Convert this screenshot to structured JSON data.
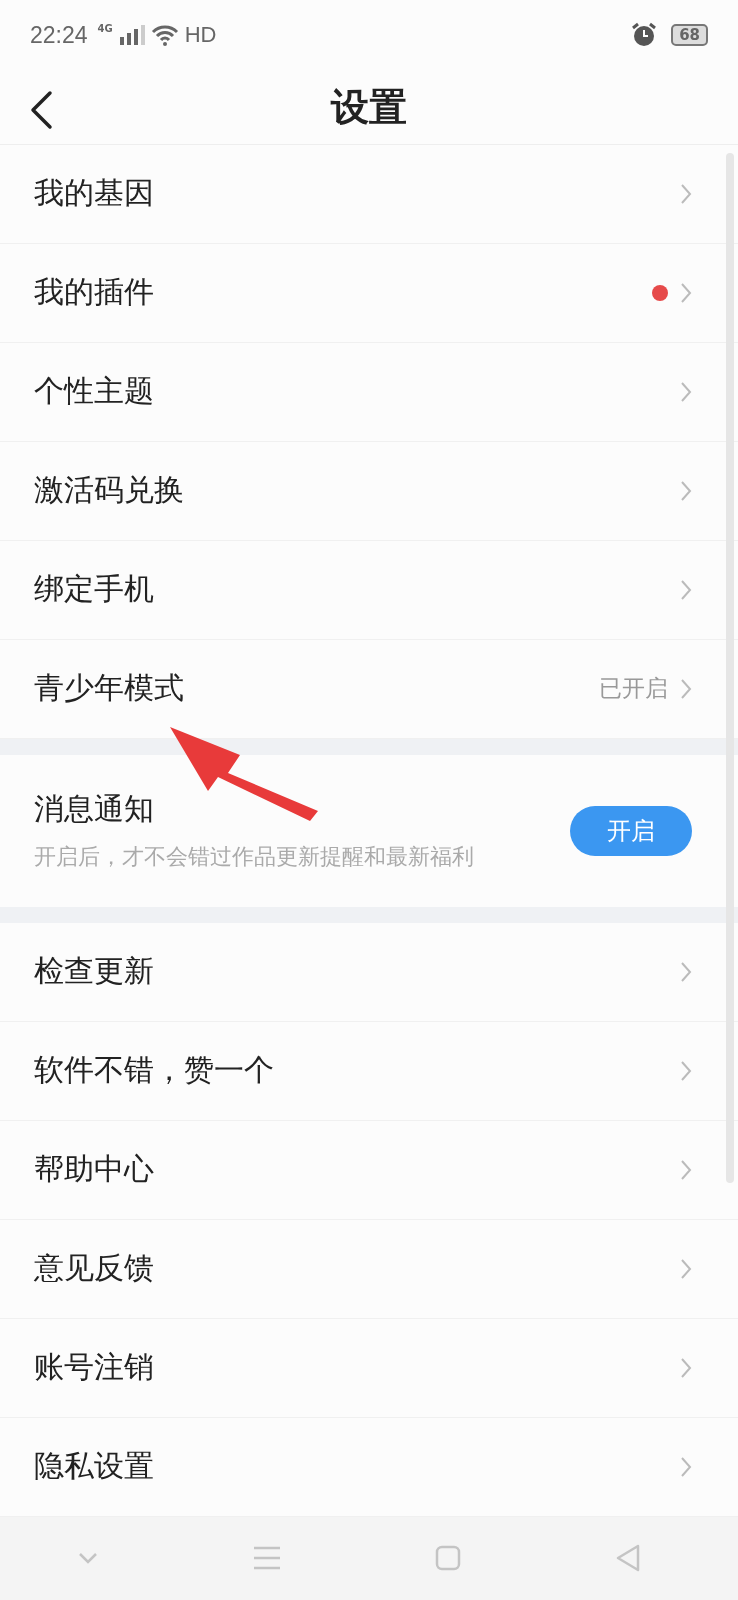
{
  "status_bar": {
    "time": "22:24",
    "network": "4G",
    "wifi_label": "HD",
    "battery": "68"
  },
  "header": {
    "title": "设置"
  },
  "groups": [
    {
      "kind": "list",
      "items": [
        {
          "label": "我的基因",
          "dot": false
        },
        {
          "label": "我的插件",
          "dot": true
        },
        {
          "label": "个性主题",
          "dot": false
        },
        {
          "label": "激活码兑换",
          "dot": false
        },
        {
          "label": "绑定手机",
          "dot": false
        },
        {
          "label": "青少年模式",
          "dot": false,
          "value": "已开启"
        }
      ]
    },
    {
      "kind": "notice",
      "title": "消息通知",
      "subtitle": "开启后，才不会错过作品更新提醒和最新福利",
      "button": "开启"
    },
    {
      "kind": "list",
      "items": [
        {
          "label": "检查更新",
          "dot": false
        },
        {
          "label": "软件不错，赞一个",
          "dot": false
        },
        {
          "label": "帮助中心",
          "dot": false
        },
        {
          "label": "意见反馈",
          "dot": false
        },
        {
          "label": "账号注销",
          "dot": false
        },
        {
          "label": "隐私设置",
          "dot": false
        }
      ]
    }
  ]
}
